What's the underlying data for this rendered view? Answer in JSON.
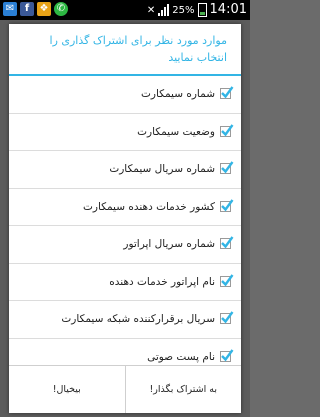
{
  "statusbar": {
    "time": "14:01",
    "battery": "25%",
    "notification_icons": [
      "mail-icon",
      "facebook-icon",
      "gift-icon",
      "whatsapp-icon"
    ]
  },
  "dialog": {
    "title": "موارد مورد نظر برای اشتراک گذاری را انتخاب نمایید",
    "items": [
      {
        "label": "شماره سیمکارت",
        "checked": true
      },
      {
        "label": "وضعیت سیمکارت",
        "checked": true
      },
      {
        "label": "شماره سریال سیمکارت",
        "checked": true
      },
      {
        "label": "کشور خدمات دهنده سیمکارت",
        "checked": true
      },
      {
        "label": "شماره سریال اپراتور",
        "checked": true
      },
      {
        "label": "نام اپراتور خدمات دهنده",
        "checked": true
      },
      {
        "label": "سریال برقرارکننده شبکه سیمکارت",
        "checked": true
      },
      {
        "label": "نام پست صوتی",
        "checked": true
      }
    ],
    "buttons": {
      "cancel": "بیخیال!",
      "share": "به اشتراک بگذار!"
    }
  },
  "colors": {
    "accent": "#33b5e5",
    "check": "#33b5e5"
  }
}
